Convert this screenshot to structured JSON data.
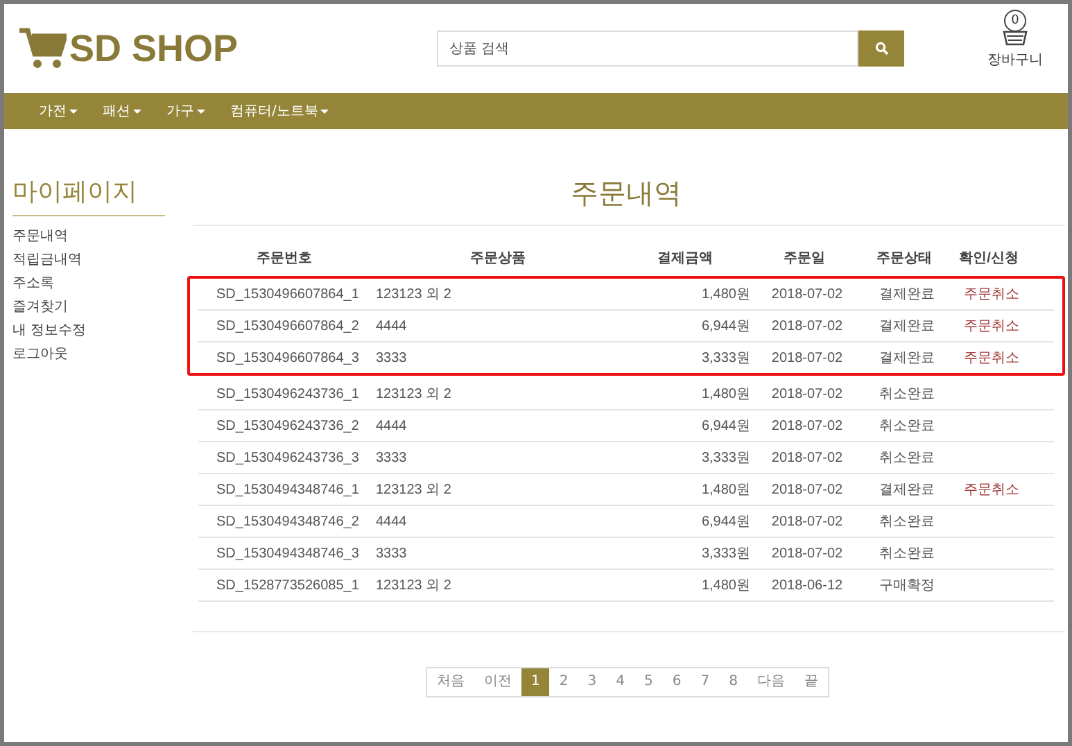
{
  "header": {
    "logo": "SD SHOP",
    "search": {
      "placeholder": "상품 검색"
    },
    "cart": {
      "count": "0",
      "label": "장바구니"
    }
  },
  "nav": [
    {
      "label": "가전"
    },
    {
      "label": "패션"
    },
    {
      "label": "가구"
    },
    {
      "label": "컴퓨터/노트북"
    }
  ],
  "sidebar": {
    "title": "마이페이지",
    "items": [
      "주문내역",
      "적립금내역",
      "주소록",
      "즐겨찾기",
      "내 정보수정",
      "로그아웃"
    ]
  },
  "title": "주문내역",
  "table": {
    "columns": [
      "주문번호",
      "주문상품",
      "결제금액",
      "주문일",
      "주문상태",
      "확인/신청"
    ],
    "rows": [
      {
        "order": "SD_1530496607864_1",
        "product": "123123 외 2",
        "amount": "1,480원",
        "date": "2018-07-02",
        "status": "결제완료",
        "action": "주문취소",
        "highlighted": true
      },
      {
        "order": "SD_1530496607864_2",
        "product": "4444",
        "amount": "6,944원",
        "date": "2018-07-02",
        "status": "결제완료",
        "action": "주문취소",
        "highlighted": true
      },
      {
        "order": "SD_1530496607864_3",
        "product": "3333",
        "amount": "3,333원",
        "date": "2018-07-02",
        "status": "결제완료",
        "action": "주문취소",
        "highlighted": true
      },
      {
        "order": "SD_1530496243736_1",
        "product": "123123 외 2",
        "amount": "1,480원",
        "date": "2018-07-02",
        "status": "취소완료",
        "highlighted": false
      },
      {
        "order": "SD_1530496243736_2",
        "product": "4444",
        "amount": "6,944원",
        "date": "2018-07-02",
        "status": "취소완료",
        "highlighted": false
      },
      {
        "order": "SD_1530496243736_3",
        "product": "3333",
        "amount": "3,333원",
        "date": "2018-07-02",
        "status": "취소완료",
        "highlighted": false
      },
      {
        "order": "SD_1530494348746_1",
        "product": "123123 외 2",
        "amount": "1,480원",
        "date": "2018-07-02",
        "status": "결제완료",
        "action": "주문취소",
        "highlighted": false
      },
      {
        "order": "SD_1530494348746_2",
        "product": "4444",
        "amount": "6,944원",
        "date": "2018-07-02",
        "status": "취소완료",
        "highlighted": false
      },
      {
        "order": "SD_1530494348746_3",
        "product": "3333",
        "amount": "3,333원",
        "date": "2018-07-02",
        "status": "취소완료",
        "highlighted": false
      },
      {
        "order": "SD_1528773526085_1",
        "product": "123123 외 2",
        "amount": "1,480원",
        "date": "2018-06-12",
        "status": "구매확정",
        "highlighted": false
      }
    ]
  },
  "pagination": [
    {
      "label": "처음",
      "selected": false
    },
    {
      "label": "이전",
      "selected": false
    },
    {
      "label": "1",
      "selected": true
    },
    {
      "label": "2",
      "selected": false
    },
    {
      "label": "3",
      "selected": false
    },
    {
      "label": "4",
      "selected": false
    },
    {
      "label": "5",
      "selected": false
    },
    {
      "label": "6",
      "selected": false
    },
    {
      "label": "7",
      "selected": false
    },
    {
      "label": "8",
      "selected": false
    },
    {
      "label": "다음",
      "selected": false
    },
    {
      "label": "끝",
      "selected": false
    }
  ]
}
